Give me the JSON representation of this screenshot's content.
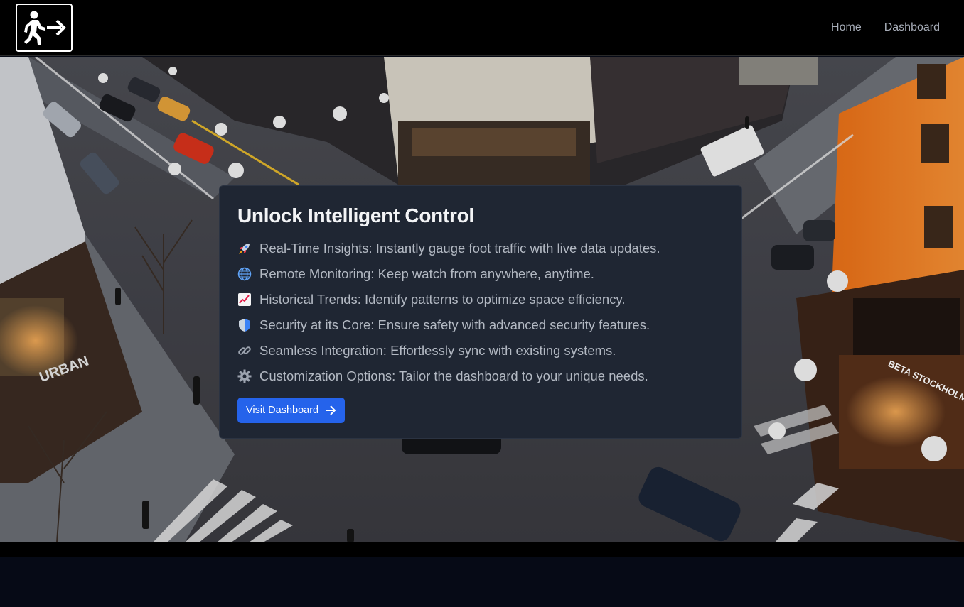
{
  "nav": {
    "logo": "exit-walking-person-icon",
    "links": [
      {
        "label": "Home"
      },
      {
        "label": "Dashboard"
      }
    ]
  },
  "hero": {
    "background": "city-street-intersection-photo",
    "card": {
      "title": "Unlock Intelligent Control",
      "features": [
        {
          "icon": "rocket-icon",
          "text": "Real-Time Insights: Instantly gauge foot traffic with live data updates."
        },
        {
          "icon": "globe-icon",
          "text": "Remote Monitoring: Keep watch from anywhere, anytime."
        },
        {
          "icon": "chart-increasing-icon",
          "text": "Historical Trends: Identify patterns to optimize space efficiency."
        },
        {
          "icon": "shield-icon",
          "text": "Security at its Core: Ensure safety with advanced security features."
        },
        {
          "icon": "link-icon",
          "text": "Seamless Integration: Effortlessly sync with existing systems."
        },
        {
          "icon": "gear-icon",
          "text": "Customization Options: Tailor the dashboard to your unique needs."
        }
      ],
      "button": {
        "label": "Visit Dashboard",
        "icon": "arrow-right-icon"
      }
    }
  },
  "colors": {
    "navbar": "#000000",
    "card": "#1f2633",
    "button": "#2563eb",
    "page_bg": "#060a16",
    "building_orange": "#f07a1c"
  }
}
